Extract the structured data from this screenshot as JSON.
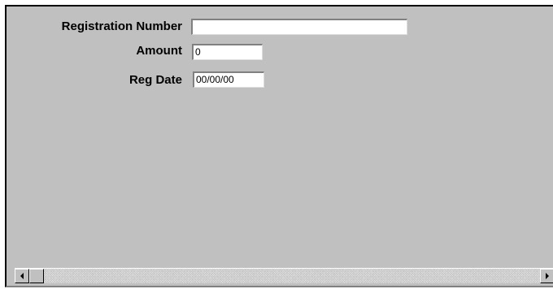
{
  "form": {
    "registration_number": {
      "label": "Registration Number",
      "value": ""
    },
    "amount": {
      "label": "Amount",
      "value": "0"
    },
    "reg_date": {
      "label": "Reg Date",
      "value": "00/00/00"
    }
  },
  "scrollbar": {
    "left_icon": "arrow-left-icon",
    "right_icon": "arrow-right-icon",
    "position": 0
  }
}
